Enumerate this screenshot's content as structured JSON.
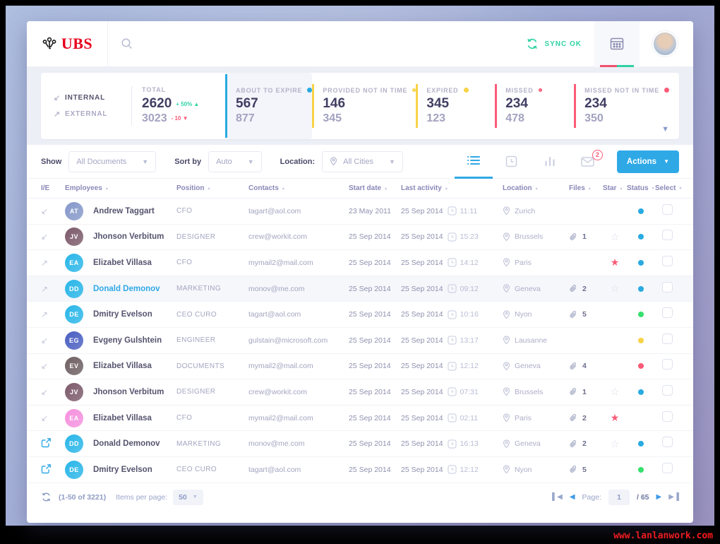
{
  "watermark": "www.lanlanwork.com",
  "header": {
    "brand": "UBS",
    "sync_label": "SYNC OK",
    "icons": {
      "logo": "ubs-keys",
      "search": "magnifier",
      "sync": "circular-arrows",
      "calendar": "calendar-grid",
      "avatar": "user-photo"
    }
  },
  "stats": {
    "internal_label": "INTERNAL",
    "external_label": "EXTERNAL",
    "total_label": "TOTAL",
    "total_internal": "2620",
    "total_internal_delta": "+ 50%",
    "total_external": "3023",
    "total_external_delta": "- 10",
    "blocks": [
      {
        "label": "ABOUT TO EXPIRE",
        "value1": "567",
        "value2": "877",
        "color": "#29aae1",
        "dot": "filled",
        "highlight": true
      },
      {
        "label": "PROVIDED NOT IN TIME",
        "value1": "146",
        "value2": "345",
        "color": "#f8d347",
        "dot": "outline",
        "highlight": false
      },
      {
        "label": "EXPIRED",
        "value1": "345",
        "value2": "123",
        "color": "#f8d347",
        "dot": "filled",
        "highlight": false
      },
      {
        "label": "MISSED",
        "value1": "234",
        "value2": "478",
        "color": "#fb5b77",
        "dot": "outline",
        "highlight": false
      },
      {
        "label": "MISSED NOT IN TIME",
        "value1": "234",
        "value2": "350",
        "color": "#fb5b77",
        "dot": "filled",
        "highlight": false
      }
    ]
  },
  "filters": {
    "show_label": "Show",
    "show_value": "All Documents",
    "sort_label": "Sort by",
    "sort_value": "Auto",
    "location_label": "Location:",
    "location_value": "All Cities",
    "mail_badge": "2",
    "actions_label": "Actions",
    "view_tabs": [
      "list-view",
      "schedule-view",
      "chart-view",
      "mail-view"
    ]
  },
  "table": {
    "columns": [
      {
        "label": "I/E",
        "sort": ""
      },
      {
        "label": "Employees",
        "sort": "up"
      },
      {
        "label": "Position",
        "sort": "up"
      },
      {
        "label": "Contacts",
        "sort": "up"
      },
      {
        "label": "Start date",
        "sort": "up"
      },
      {
        "label": "Last activity",
        "sort": "up"
      },
      {
        "label": "Location",
        "sort": "up"
      },
      {
        "label": "Files",
        "sort": "up"
      },
      {
        "label": "Star",
        "sort": "up"
      },
      {
        "label": "Status",
        "sort": "down"
      },
      {
        "label": "Select",
        "sort": "down"
      }
    ],
    "rows": [
      {
        "ie": "internal",
        "initials": "AT",
        "avatar_color": "#8598c9",
        "name": "Andrew Taggart",
        "name_blue": false,
        "position": "CFO",
        "contact": "tagart@aol.com",
        "start": "23 May 2011",
        "last_date": "25 Sep 2014",
        "last_time": "11:11",
        "city": "Zurich",
        "files": "",
        "star": "",
        "status": "#29aae1",
        "highlight": false
      },
      {
        "ie": "internal",
        "initials": "JV",
        "avatar_color": "#7c5a6b",
        "name": "Jhonson Verbitum",
        "name_blue": false,
        "position": "DESIGNER",
        "contact": "crew@workit.com",
        "start": "25 Sep 2014",
        "last_date": "25 Sep 2014",
        "last_time": "15:23",
        "city": "Brussels",
        "files": "1",
        "star": "empty",
        "status": "#29aae1",
        "highlight": false
      },
      {
        "ie": "external",
        "initials": "EA",
        "avatar_color": "#29b6e8",
        "name": "Elizabet Villasa",
        "name_blue": false,
        "position": "CFO",
        "contact": "mymail2@mail.com",
        "start": "25 Sep 2014",
        "last_date": "25 Sep 2014",
        "last_time": "14:12",
        "city": "Paris",
        "files": "",
        "star": "filled",
        "status": "#29aae1",
        "highlight": false
      },
      {
        "ie": "external",
        "initials": "DD",
        "avatar_color": "#29b6e8",
        "name": "Donald Demonov",
        "name_blue": true,
        "position": "MARKETING",
        "contact": "monov@me.com",
        "start": "25 Sep 2014",
        "last_date": "25 Sep 2014",
        "last_time": "09:12",
        "city": "Geneva",
        "files": "2",
        "star": "empty",
        "status": "#29aae1",
        "highlight": true
      },
      {
        "ie": "external",
        "initials": "DE",
        "avatar_color": "#29b6e8",
        "name": "Dmitry Evelson",
        "name_blue": false,
        "position": "CEO CURO",
        "contact": "tagart@aol.com",
        "start": "25 Sep 2014",
        "last_date": "25 Sep 2014",
        "last_time": "10:16",
        "city": "Nyon",
        "files": "5",
        "star": "",
        "status": "#35e06d",
        "highlight": false
      },
      {
        "ie": "internal",
        "initials": "EG",
        "avatar_color": "#4a5fc1",
        "name": "Evgeny Gulshtein",
        "name_blue": false,
        "position": "ENGINEER",
        "contact": "gulstain@microsoft.com",
        "start": "25 Sep 2014",
        "last_date": "25 Sep 2014",
        "last_time": "13:17",
        "city": "Lausanne",
        "files": "",
        "star": "",
        "status": "#f8d347",
        "highlight": false
      },
      {
        "ie": "internal",
        "initials": "EV",
        "avatar_color": "#6e5f63",
        "name": "Elizabet Villasa",
        "name_blue": false,
        "position": "DOCUMENTS",
        "contact": "mymail2@mail.com",
        "start": "25 Sep 2014",
        "last_date": "25 Sep 2014",
        "last_time": "12:12",
        "city": "Geneva",
        "files": "4",
        "star": "",
        "status": "#fb5b77",
        "highlight": false
      },
      {
        "ie": "internal",
        "initials": "JV",
        "avatar_color": "#7c5a6b",
        "name": "Jhonson Verbitum",
        "name_blue": false,
        "position": "DESIGNER",
        "contact": "crew@workit.com",
        "start": "25 Sep 2014",
        "last_date": "25 Sep 2014",
        "last_time": "07:31",
        "city": "Brussels",
        "files": "1",
        "star": "empty",
        "status": "#29aae1",
        "highlight": false
      },
      {
        "ie": "internal",
        "initials": "EA",
        "avatar_color": "#f590de",
        "name": "Elizabet Villasa",
        "name_blue": false,
        "position": "CFO",
        "contact": "mymail2@mail.com",
        "start": "25 Sep 2014",
        "last_date": "25 Sep 2014",
        "last_time": "02:11",
        "city": "Paris",
        "files": "2",
        "star": "filled",
        "status": "",
        "highlight": false
      },
      {
        "ie": "link",
        "initials": "DD",
        "avatar_color": "#29b6e8",
        "name": "Donald Demonov",
        "name_blue": false,
        "position": "MARKETING",
        "contact": "monov@me.com",
        "start": "25 Sep 2014",
        "last_date": "25 Sep 2014",
        "last_time": "16:13",
        "city": "Geneva",
        "files": "2",
        "star": "empty",
        "status": "#29aae1",
        "highlight": false
      },
      {
        "ie": "link",
        "initials": "DE",
        "avatar_color": "#29b6e8",
        "name": "Dmitry Evelson",
        "name_blue": false,
        "position": "CEO CURO",
        "contact": "tagart@aol.com",
        "start": "25 Sep 2014",
        "last_date": "25 Sep 2014",
        "last_time": "12:12",
        "city": "Nyon",
        "files": "5",
        "star": "",
        "status": "#35e06d",
        "highlight": false
      }
    ]
  },
  "footer": {
    "range": "(1-50 of 3221)",
    "items_label": "Items per page:",
    "items_value": "50",
    "page_label": "Page:",
    "page_value": "1",
    "total_pages": "/ 65"
  }
}
